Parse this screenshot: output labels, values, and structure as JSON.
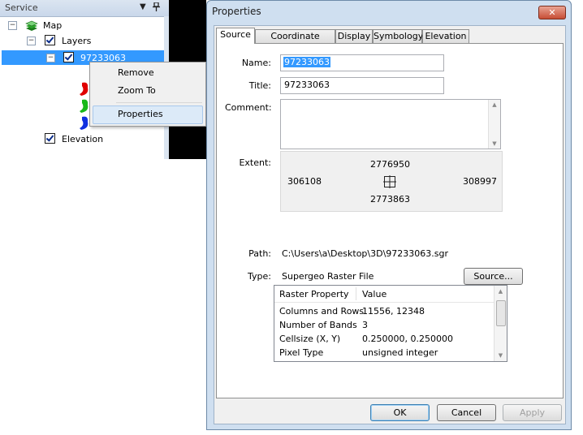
{
  "service": {
    "title": "Service",
    "dropdown_glyph": "▼",
    "pin_glyph": "📌",
    "tree": {
      "map": {
        "label": "Map",
        "expander": "−"
      },
      "layers": {
        "label": "Layers",
        "expander": "−"
      },
      "raster": {
        "label": "97233063",
        "expander": "−"
      },
      "elevation": {
        "label": "Elevation"
      }
    }
  },
  "context_menu": {
    "items": [
      {
        "label": "Remove"
      },
      {
        "label": "Zoom To"
      },
      {
        "label": "Properties"
      }
    ]
  },
  "dialog": {
    "title": "Properties",
    "close_glyph": "✕",
    "tabs": [
      {
        "label": "Source",
        "active": true
      },
      {
        "label": "Coordinate System",
        "active": false
      },
      {
        "label": "Display",
        "active": false
      },
      {
        "label": "Symbology",
        "active": false
      },
      {
        "label": "Elevation",
        "active": false
      }
    ],
    "fields": {
      "name_label": "Name:",
      "name_value": "97233063",
      "title_label": "Title:",
      "title_value": "97233063",
      "comment_label": "Comment:",
      "comment_value": "",
      "extent_label": "Extent:",
      "extent": {
        "top": "2776950",
        "left": "306108",
        "right": "308997",
        "bottom": "2773863"
      },
      "path_label": "Path:",
      "path_value": "C:\\Users\\a\\Desktop\\3D\\97233063.sgr",
      "type_label": "Type:",
      "type_value": "Supergeo Raster File",
      "source_button": "Source..."
    },
    "grid": {
      "headers": [
        "Raster Property",
        "Value"
      ],
      "rows": [
        [
          "Columns and Rows",
          "11556, 12348"
        ],
        [
          "Number of Bands",
          "3"
        ],
        [
          "Cellsize (X, Y)",
          "0.250000, 0.250000"
        ],
        [
          "Pixel Type",
          "unsigned integer"
        ]
      ]
    },
    "buttons": {
      "ok": "OK",
      "cancel": "Cancel",
      "apply": "Apply"
    },
    "colors": {
      "selection": "#3399ff",
      "band_red": "#e00000",
      "band_green": "#18b818",
      "band_blue": "#1030e0"
    }
  }
}
